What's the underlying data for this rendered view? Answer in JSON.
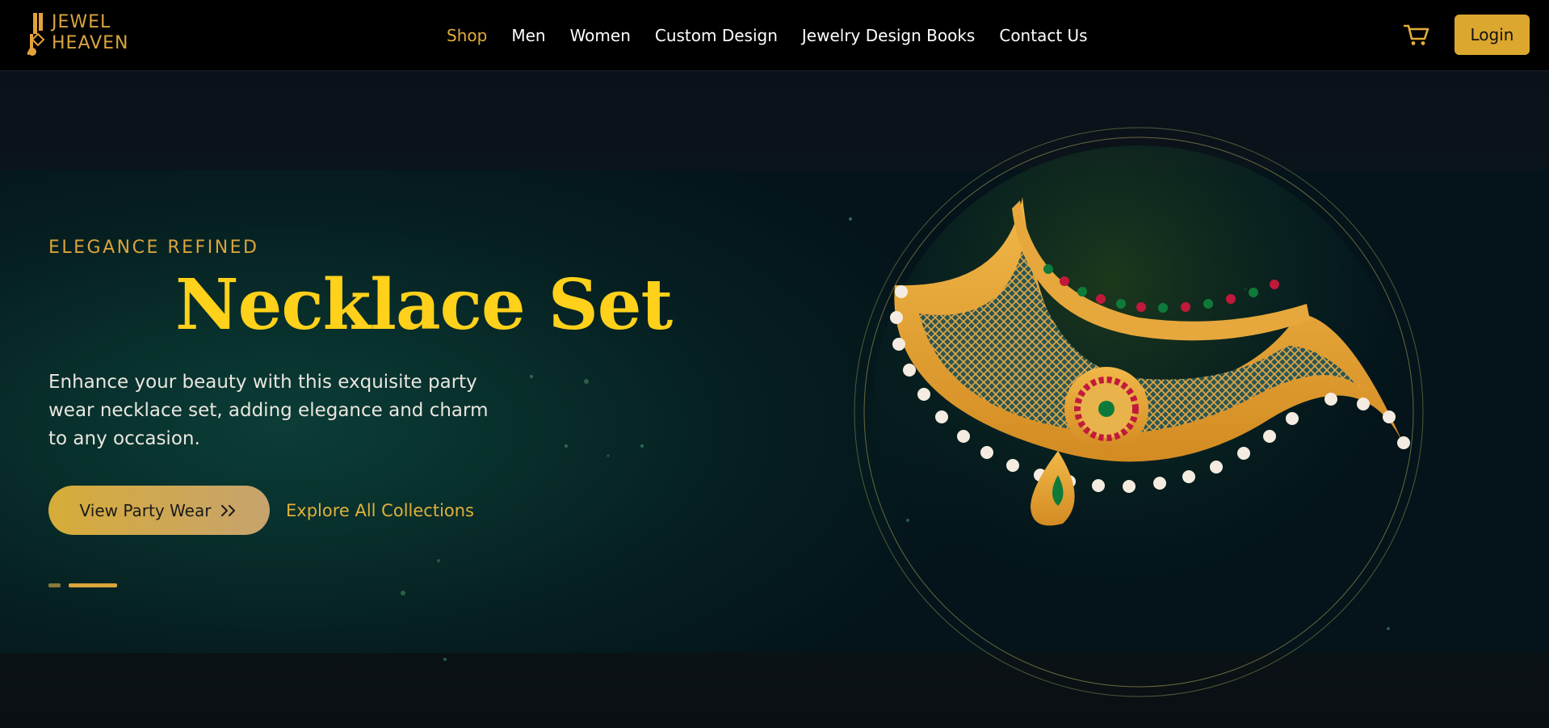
{
  "brand": {
    "line1": "JEWEL",
    "line2": "HEAVEN"
  },
  "nav": {
    "items": [
      {
        "label": "Shop",
        "active": true
      },
      {
        "label": "Men"
      },
      {
        "label": "Women"
      },
      {
        "label": "Custom Design"
      },
      {
        "label": "Jewelry Design Books"
      },
      {
        "label": "Contact Us"
      }
    ]
  },
  "header": {
    "login_label": "Login",
    "cart_icon": "cart-icon"
  },
  "hero": {
    "eyebrow": "ELEGANCE REFINED",
    "title": "Necklace Set",
    "description": "Enhance your beauty with this exquisite party wear necklace set, adding elegance and charm to any occasion.",
    "primary_cta": "View Party Wear",
    "secondary_cta": "Explore All Collections",
    "slide_count": 2,
    "active_slide": 2
  },
  "colors": {
    "accent_gold": "#d9a53c",
    "title_yellow": "#ffd11a",
    "header_bg": "#000000",
    "hero_teal": "#0b3d36"
  }
}
